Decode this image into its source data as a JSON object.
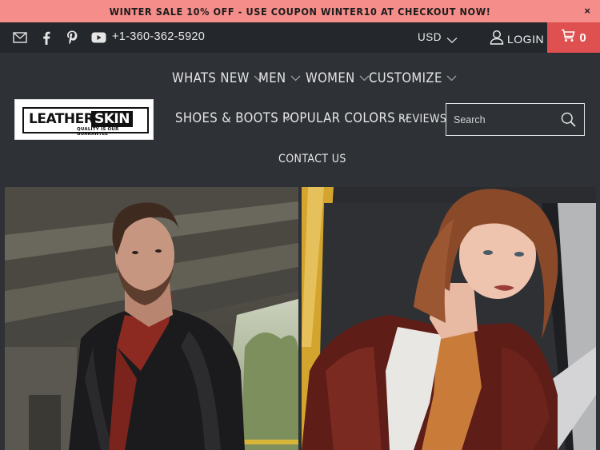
{
  "announcement": {
    "text": "WINTER SALE 10% OFF - USE COUPON WINTER10 AT CHECKOUT NOW!",
    "close": "×"
  },
  "topbar": {
    "social_icons": [
      "mail-icon",
      "facebook-icon",
      "pinterest-icon",
      "youtube-icon"
    ],
    "phone": "+1-360-362-5920",
    "currency": "USD",
    "login": "LOGIN",
    "cart_count": "0"
  },
  "header": {
    "logo": {
      "word1": "LEATHER",
      "word2": "SKIN",
      "tagline": "QUALITY IS OUR GUARANTEE"
    },
    "nav": {
      "whats_new": "WHATS NEW",
      "men": "MEN",
      "women": "WOMEN",
      "customize": "CUSTOMIZE",
      "shoes_boots": "SHOES & BOOTS",
      "popular_colors": "POPULAR COLORS",
      "reviews": "REVIEWS",
      "contact_us": "CONTACT US"
    },
    "search": {
      "placeholder": "Search"
    }
  },
  "colors": {
    "announcement_bg": "#f58e8a",
    "topbar_bg": "#24272b",
    "header_bg": "#2e3135",
    "cart_bg": "#df5050"
  }
}
